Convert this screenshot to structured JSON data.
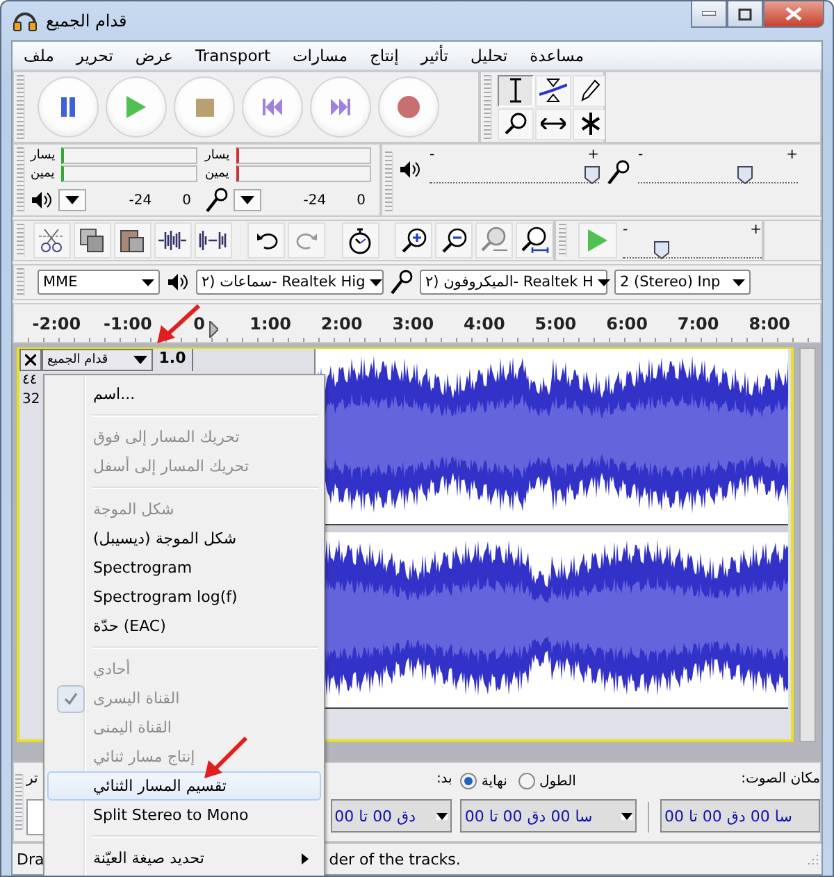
{
  "window": {
    "title": "قدام الجميع"
  },
  "menu_bar": [
    "مساعدة",
    "تحليل",
    "تأثير",
    "إنتاج",
    "مسارات",
    "Transport",
    "عرض",
    "تحرير",
    "ملف"
  ],
  "meters": [
    {
      "kind": "recording",
      "channels": [
        "يسار",
        "يمين"
      ],
      "scale": [
        "0",
        "-24"
      ]
    },
    {
      "kind": "playback",
      "channels": [
        "يسار",
        "يمين"
      ],
      "scale": [
        "0",
        "-24"
      ]
    }
  ],
  "mixer": [
    {
      "kind": "recording",
      "level": 0.67,
      "max_label": "+",
      "min_label": "-"
    },
    {
      "kind": "playback",
      "level": 0.96,
      "max_label": "+",
      "min_label": "-"
    }
  ],
  "play_at_speed": {
    "level": 0.28,
    "max_label": "+",
    "min_label": "-"
  },
  "devices": {
    "host": "MME",
    "output": "سماعات (٢- Realtek Hig",
    "input": "الميكروفون (٢- Realtek H",
    "channels": "2 (Stereo) Inp"
  },
  "ruler": {
    "labels": [
      "8:00",
      "7:00",
      "6:00",
      "5:00",
      "4:00",
      "3:00",
      "2:00",
      "1:00",
      "0",
      "-1:00",
      "-2:00"
    ]
  },
  "track": {
    "name": "قدام الجميع",
    "gain": "1.0",
    "info": [
      "٤٤",
      "32"
    ]
  },
  "context_menu": {
    "items": [
      {
        "kind": "item",
        "label": "اسم...",
        "disabled": false,
        "checked": false,
        "selected": false,
        "submenu": false
      },
      {
        "kind": "separator"
      },
      {
        "kind": "item",
        "label": "تحريك المسار إلى فوق",
        "disabled": true,
        "checked": false,
        "selected": false,
        "submenu": false
      },
      {
        "kind": "item",
        "label": "تحريك المسار إلى أسفل",
        "disabled": true,
        "checked": false,
        "selected": false,
        "submenu": false
      },
      {
        "kind": "separator"
      },
      {
        "kind": "item",
        "label": "شكل الموجة",
        "disabled": true,
        "checked": false,
        "selected": false,
        "submenu": false
      },
      {
        "kind": "item",
        "label": "شكل الموجة (ديسيبل)",
        "disabled": false,
        "checked": false,
        "selected": false,
        "submenu": false
      },
      {
        "kind": "item",
        "label": "Spectrogram",
        "disabled": false,
        "checked": false,
        "selected": false,
        "submenu": false
      },
      {
        "kind": "item",
        "label": "Spectrogram log(f)",
        "disabled": false,
        "checked": false,
        "selected": false,
        "submenu": false
      },
      {
        "kind": "item",
        "label": "حدّة (EAC)",
        "disabled": false,
        "checked": false,
        "selected": false,
        "submenu": false
      },
      {
        "kind": "separator"
      },
      {
        "kind": "item",
        "label": "أحادي",
        "disabled": true,
        "checked": false,
        "selected": false,
        "submenu": false
      },
      {
        "kind": "item",
        "label": "القناة اليسرى",
        "disabled": true,
        "checked": true,
        "selected": false,
        "submenu": false
      },
      {
        "kind": "item",
        "label": "القناة اليمنى",
        "disabled": true,
        "checked": false,
        "selected": false,
        "submenu": false
      },
      {
        "kind": "item",
        "label": "إنتاج مسار ثنائي",
        "disabled": true,
        "checked": false,
        "selected": false,
        "submenu": false
      },
      {
        "kind": "item",
        "label": "تقسيم المسار الثنائي",
        "disabled": false,
        "checked": false,
        "selected": true,
        "submenu": false
      },
      {
        "kind": "item",
        "label": "Split Stereo to Mono",
        "disabled": false,
        "checked": false,
        "selected": false,
        "submenu": false
      },
      {
        "kind": "separator"
      },
      {
        "kind": "item",
        "label": "تحديد صيغة العيّنة",
        "disabled": false,
        "checked": false,
        "selected": false,
        "submenu": true
      }
    ]
  },
  "selection_bar": {
    "position_label": "مكان الصوت:",
    "position_field": "00 سا 00 دق 00 تا",
    "radios": [
      {
        "label": "الطول",
        "selected": false
      },
      {
        "label": "نهاية",
        "selected": true
      }
    ],
    "end_field": "00 سا 00 دق 00 تا",
    "start_label": "بد:",
    "start_field": "00 دق 00 تا",
    "left_label": "تر"
  },
  "status_bar": [
    "der of the tracks.",
    "Dra"
  ]
}
